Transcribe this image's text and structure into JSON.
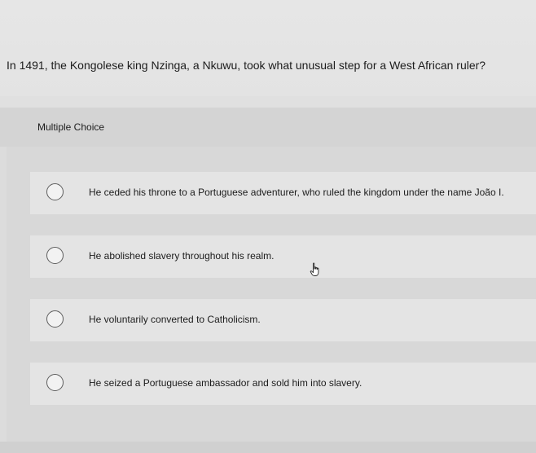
{
  "question": {
    "text": "In 1491, the Kongolese king Nzinga, a Nkuwu, took what unusual step for a West African ruler?"
  },
  "section": {
    "label": "Multiple Choice"
  },
  "options": [
    {
      "label": "He ceded his throne to a Portuguese adventurer, who ruled the kingdom under the name João I.",
      "selected": false
    },
    {
      "label": "He abolished slavery throughout his realm.",
      "selected": false
    },
    {
      "label": "He voluntarily converted to Catholicism.",
      "selected": false
    },
    {
      "label": "He seized a Portuguese ambassador and sold him into slavery.",
      "selected": false
    }
  ],
  "colors": {
    "page_background": "#dcdcdc",
    "option_background": "#e4e4e4",
    "text": "#1c1c1c",
    "radio_border": "#5d5d5d"
  },
  "icons": {
    "cursor": "hand-pointer-icon",
    "radio": "radio-button-icon"
  }
}
